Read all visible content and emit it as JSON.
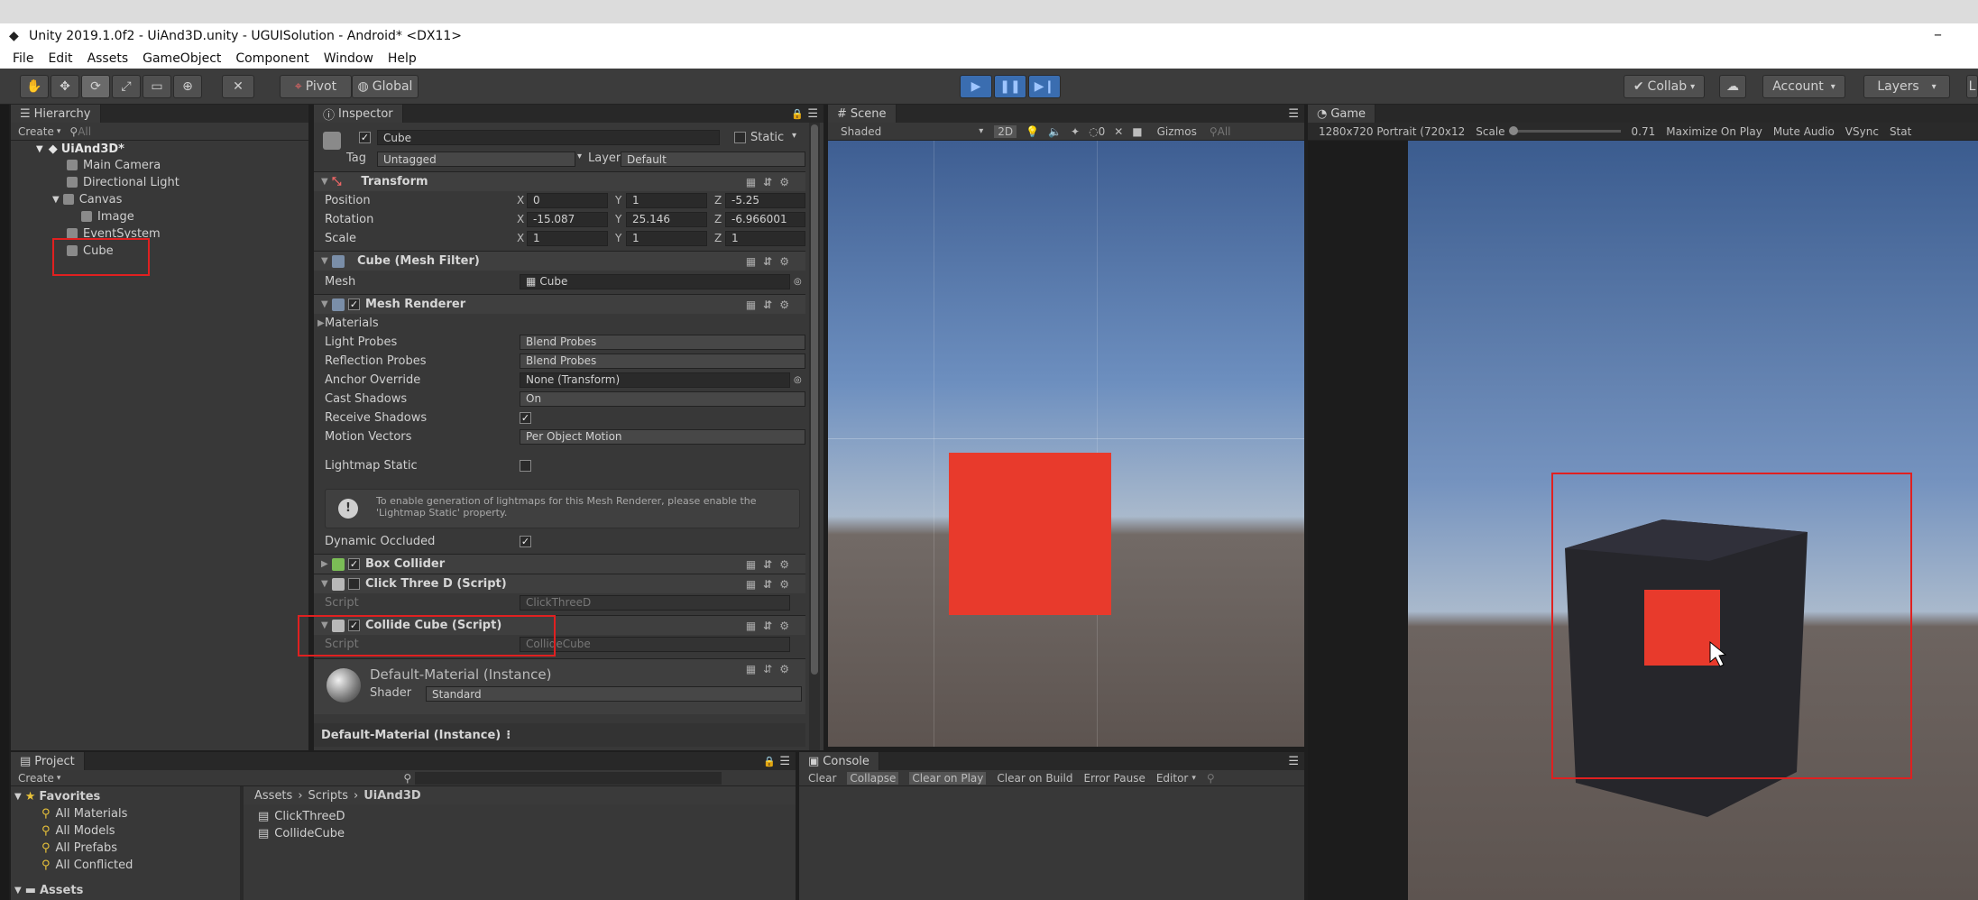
{
  "window": {
    "title": "Unity 2019.1.0f2 - UiAnd3D.unity - UGUISolution - Android* <DX11>",
    "minimize": "–"
  },
  "menu": [
    "File",
    "Edit",
    "Assets",
    "GameObject",
    "Component",
    "Window",
    "Help"
  ],
  "toolbar": {
    "tools": [
      "hand-tool",
      "move-tool",
      "rotate-tool",
      "scale-tool",
      "rect-tool",
      "transform-tool",
      "custom-tool"
    ],
    "pivot": "Pivot",
    "global": "Global",
    "collab": "Collab",
    "account": "Account",
    "layers": "Layers",
    "layout": "L"
  },
  "hierarchy": {
    "tab": "Hierarchy",
    "create": "Create",
    "search_placeholder": "All",
    "scene": "UiAnd3D*",
    "items": [
      "Main Camera",
      "Directional Light",
      "Canvas",
      "Image",
      "EventSystem",
      "Cube"
    ]
  },
  "inspector": {
    "tab": "Inspector",
    "object_name": "Cube",
    "static_label": "Static",
    "tag_label": "Tag",
    "tag_value": "Untagged",
    "layer_label": "Layer",
    "layer_value": "Default",
    "transform": {
      "title": "Transform",
      "position_label": "Position",
      "position": {
        "x": "0",
        "y": "1",
        "z": "-5.25"
      },
      "rotation_label": "Rotation",
      "rotation": {
        "x": "-15.087",
        "y": "25.146",
        "z": "-6.966001"
      },
      "scale_label": "Scale",
      "scale": {
        "x": "1",
        "y": "1",
        "z": "1"
      }
    },
    "mesh_filter": {
      "title": "Cube (Mesh Filter)",
      "mesh_label": "Mesh",
      "mesh_value": "Cube"
    },
    "mesh_renderer": {
      "title": "Mesh Renderer",
      "materials": "Materials",
      "light_probes_label": "Light Probes",
      "light_probes": "Blend Probes",
      "reflection_probes_label": "Reflection Probes",
      "reflection_probes": "Blend Probes",
      "anchor_override_label": "Anchor Override",
      "anchor_override": "None (Transform)",
      "cast_shadows_label": "Cast Shadows",
      "cast_shadows": "On",
      "receive_shadows_label": "Receive Shadows",
      "motion_vectors_label": "Motion Vectors",
      "motion_vectors": "Per Object Motion",
      "lightmap_static_label": "Lightmap Static",
      "info": "To enable generation of lightmaps for this Mesh Renderer, please enable the 'Lightmap Static' property.",
      "dynamic_occluded_label": "Dynamic Occluded"
    },
    "box_collider": {
      "title": "Box Collider"
    },
    "click_three_d": {
      "title": "Click Three D (Script)",
      "script_label": "Script",
      "script_value": "ClickThreeD"
    },
    "collide_cube": {
      "title": "Collide Cube (Script)",
      "script_label": "Script",
      "script_value": "CollideCube"
    },
    "material": {
      "title": "Default-Material (Instance)",
      "shader_label": "Shader",
      "shader_value": "Standard",
      "footer": "Default-Material (Instance)"
    }
  },
  "scene": {
    "tab": "Scene",
    "shading": "Shaded",
    "mode_2d": "2D",
    "gizmos": "Gizmos",
    "search": "All",
    "counter": "0"
  },
  "game": {
    "tab": "Game",
    "resolution": "1280x720 Portrait (720x12",
    "scale_label": "Scale",
    "scale_value": "0.71",
    "maximize": "Maximize On Play",
    "mute": "Mute Audio",
    "vsync": "VSync",
    "stats": "Stat"
  },
  "project": {
    "tab": "Project",
    "create": "Create",
    "favorites": "Favorites",
    "fav_items": [
      "All Materials",
      "All Models",
      "All Prefabs",
      "All Conflicted"
    ],
    "assets": "Assets",
    "breadcrumb": [
      "Assets",
      "Scripts",
      "UiAnd3D"
    ],
    "files": [
      "ClickThreeD",
      "CollideCube"
    ]
  },
  "console": {
    "tab": "Console",
    "buttons": [
      "Clear",
      "Collapse",
      "Clear on Play",
      "Clear on Build",
      "Error Pause",
      "Editor"
    ]
  },
  "colors": {
    "highlight": "#e02020",
    "cube_red": "#e83a2c",
    "play_blue": "#3a6db0"
  }
}
